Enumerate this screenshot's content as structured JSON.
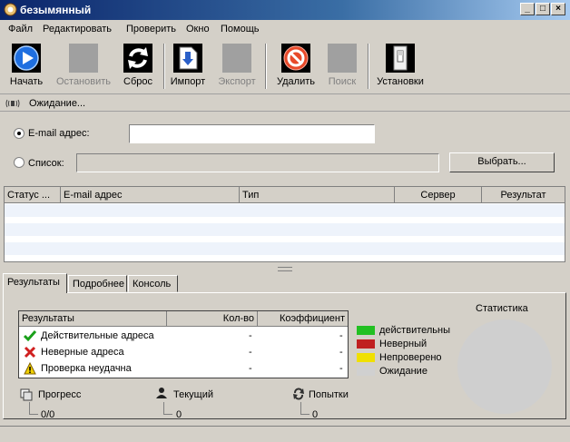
{
  "window": {
    "title": "безымянный"
  },
  "menu": [
    "Файл",
    "Редактировать",
    "Проверить",
    "Окно",
    "Помощь"
  ],
  "toolbar": {
    "start": {
      "label": "Начать",
      "icon": "play-icon"
    },
    "stop": {
      "label": "Остановить",
      "icon": "stop-icon"
    },
    "reset": {
      "label": "Сброс",
      "icon": "refresh-icon"
    },
    "import": {
      "label": "Импорт",
      "icon": "import-icon"
    },
    "export": {
      "label": "Экспорт",
      "icon": "export-icon"
    },
    "delete": {
      "label": "Удалить",
      "icon": "no-entry-icon"
    },
    "search": {
      "label": "Поиск",
      "icon": "search-icon"
    },
    "settings": {
      "label": "Установки",
      "icon": "switch-icon"
    }
  },
  "status_strip": {
    "text": "Ожидание..."
  },
  "input": {
    "email_label": "E-mail адрес:",
    "email_value": "",
    "list_label": "Список:",
    "list_value": "",
    "choose_button": "Выбрать..."
  },
  "grid": {
    "columns": [
      "Статус ...",
      "E-mail адрес",
      "Тип",
      "Сервер",
      "Результат"
    ]
  },
  "tabs": [
    "Результаты",
    "Подробнее",
    "Консоль"
  ],
  "results": {
    "headers": [
      "Результаты",
      "Кол-во",
      "Коэффициент"
    ],
    "rows": [
      {
        "label": "Действительные адреса",
        "count": "-",
        "coef": "-",
        "icon": "check-icon"
      },
      {
        "label": "Неверные адреса",
        "count": "-",
        "coef": "-",
        "icon": "cross-icon"
      },
      {
        "label": "Проверка неудачна",
        "count": "-",
        "coef": "-",
        "icon": "warning-icon"
      }
    ]
  },
  "legend": {
    "items": [
      {
        "label": "действительны",
        "color": "#22c022"
      },
      {
        "label": "Неверный",
        "color": "#c02020"
      },
      {
        "label": "Непроверено",
        "color": "#f0e000"
      },
      {
        "label": "Ожидание",
        "color": "#d0d0d0"
      }
    ]
  },
  "statistics": {
    "title": "Статистика"
  },
  "counters": {
    "progress": {
      "label": "Прогресс",
      "value": "0/0"
    },
    "current": {
      "label": "Текущий",
      "value": "0"
    },
    "attempts": {
      "label": "Попытки",
      "value": "0"
    }
  }
}
